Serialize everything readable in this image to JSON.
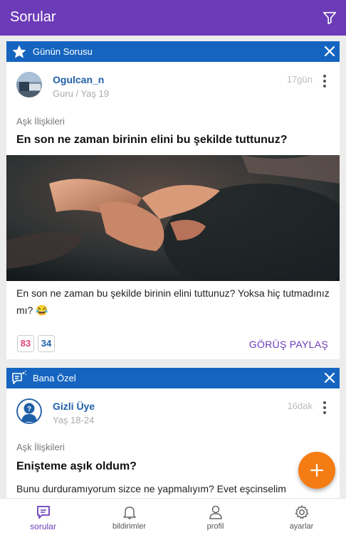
{
  "app_bar": {
    "title": "Sorular",
    "icon": "filter-icon"
  },
  "cards": [
    {
      "header": {
        "label": "Günün Sorusu",
        "icon": "star-icon",
        "color": "#1565c0"
      },
      "user": {
        "name": "Ogulcan_n",
        "meta": "Guru / Yaş 19",
        "time": "17gün"
      },
      "category": "Aşk İlişkileri",
      "title": "En son ne zaman birinin elini bu şekilde tuttunuz?",
      "body_line1": "En son ne zaman bu şekilde birinin elini tuttunuz? Yoksa hiç tutmadınız",
      "body_line2": "mı? 😂",
      "stats": {
        "opinions": "83",
        "votes": "34"
      },
      "action": "GÖRÜŞ PAYLAŞ"
    },
    {
      "header": {
        "label": "Bana Özel",
        "icon": "special-message-icon",
        "color": "#1565c0"
      },
      "user": {
        "name": "Gizli Üye",
        "meta": "Yaş 18-24",
        "time": "16dak"
      },
      "category": "Aşk İlişkileri",
      "title": "Enişteme aşık oldum?",
      "body_line1": "Bunu durduramıyorum sizce ne yapmalıyım? Evet eşcinselim"
    }
  ],
  "fab": {
    "icon": "plus-icon",
    "color": "#f57c12"
  },
  "bottom_nav": [
    {
      "label": "sorular",
      "icon": "questions-icon",
      "active": true
    },
    {
      "label": "bildirimler",
      "icon": "bell-icon",
      "active": false
    },
    {
      "label": "profil",
      "icon": "person-icon",
      "active": false
    },
    {
      "label": "ayarlar",
      "icon": "gear-icon",
      "active": false
    }
  ],
  "colors": {
    "primary": "#6c3bb7",
    "header_blue": "#1565c0",
    "accent": "#f57c12",
    "user_blue": "#1f5fa8"
  }
}
